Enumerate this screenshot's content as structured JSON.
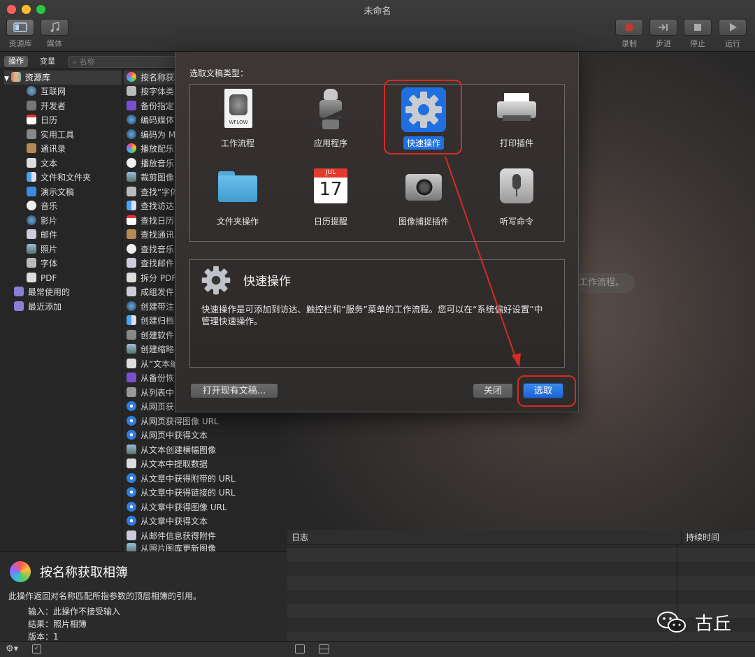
{
  "window": {
    "title": "未命名"
  },
  "toolbar": {
    "library_label": "资源库",
    "media_label": "媒体",
    "record_label": "录制",
    "step_label": "步进",
    "stop_label": "停止",
    "run_label": "运行"
  },
  "left_header": {
    "tab_actions": "操作",
    "tab_variables": "变量",
    "search_placeholder": "名称"
  },
  "library": {
    "root": "资源库",
    "items": [
      "互联网",
      "开发者",
      "日历",
      "实用工具",
      "通讯录",
      "文本",
      "文件和文件夹",
      "演示文稿",
      "音乐",
      "影片",
      "邮件",
      "照片",
      "字体",
      "PDF"
    ],
    "special": [
      "最常使用的",
      "最近添加"
    ]
  },
  "actions": [
    "按名称获取相簿",
    "按字体类型",
    "备份指定",
    "编码媒体",
    "编码为 MP",
    "播放配乐",
    "播放音乐",
    "裁剪图像",
    "查找“字体”",
    "查找访达",
    "查找日历",
    "查找通讯录",
    "查找音乐",
    "查找邮件",
    "拆分 PDF",
    "成组发件",
    "创建带注",
    "创建归档",
    "创建软件",
    "创建缩略",
    "从“文本编",
    "从备份恢",
    "从列表中",
    "从网页获",
    "从网页获得图像 URL",
    "从网页中获得文本",
    "从文本创建横幅图像",
    "从文本中提取数据",
    "从文章中获得附带的 URL",
    "从文章中获得链接的 URL",
    "从文章中获得图像 URL",
    "从文章中获得文本",
    "从邮件信息获得附件",
    "从照片图库更新图像"
  ],
  "description": {
    "title": "按名称获取相簿",
    "body": "此操作返回对名称匹配所指参数的顶层相簿的引用。",
    "input_label": "输入：",
    "input_value": "此操作不接受输入",
    "result_label": "结果：",
    "result_value": "照片相簿",
    "version_label": "版本：",
    "version_value": "1"
  },
  "dialog": {
    "prompt": "选取文稿类型：",
    "types": [
      {
        "label": "工作流程",
        "icon": "workflow-file-icon"
      },
      {
        "label": "应用程序",
        "icon": "automator-robot-icon"
      },
      {
        "label": "快速操作",
        "icon": "gear-icon"
      },
      {
        "label": "打印插件",
        "icon": "printer-icon"
      },
      {
        "label": "文件夹操作",
        "icon": "folder-icon"
      },
      {
        "label": "日历提醒",
        "icon": "calendar-icon"
      },
      {
        "label": "图像捕捉插件",
        "icon": "camera-icon"
      },
      {
        "label": "听写命令",
        "icon": "microphone-icon"
      }
    ],
    "calendar_month": "JUL",
    "calendar_day": "17",
    "wflow_text": "WFLOW",
    "info_title": "快速操作",
    "info_body": "快速操作是可添加到访达、触控栏和“服务”菜单的工作流程。您可以在“系统偏好设置”中管理快速操作。",
    "open_existing": "打开现有文稿...",
    "close": "关闭",
    "choose": "选取"
  },
  "workflow_hint": "工作流程。",
  "log": {
    "col_log": "日志",
    "col_duration": "持续时间"
  },
  "watermark": {
    "text": "古丘"
  },
  "colors": {
    "accent": "#1f6fe0",
    "annotation_red": "#d62b22"
  }
}
